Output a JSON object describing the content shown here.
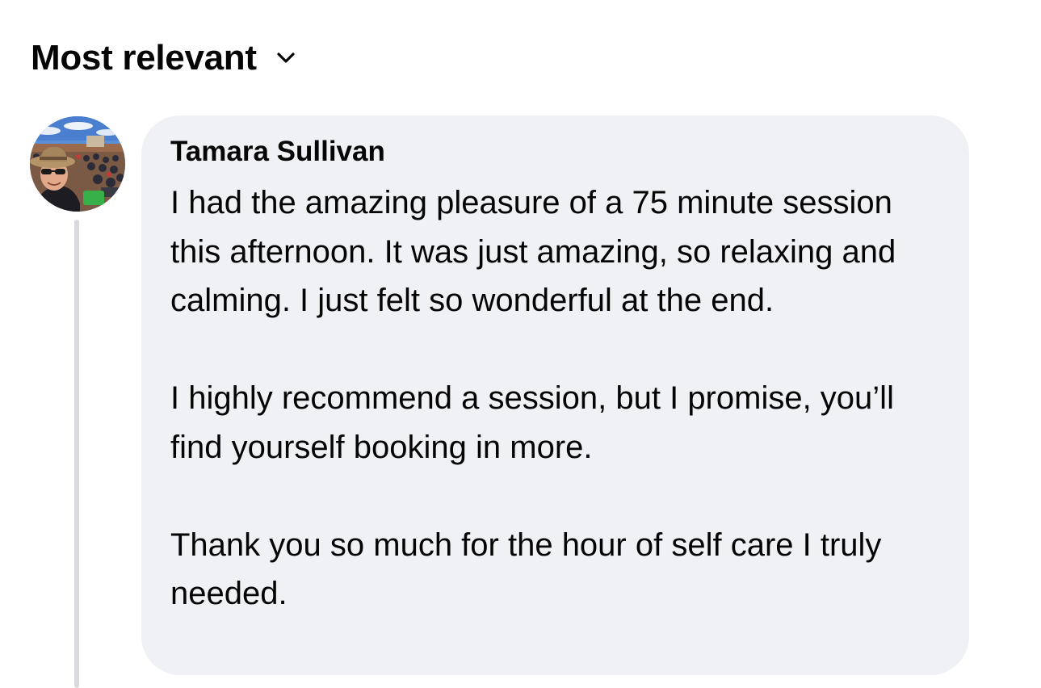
{
  "sort": {
    "label": "Most relevant",
    "icon": "chevron-down-icon"
  },
  "comment": {
    "author": "Tamara Sullivan",
    "avatar_icon": "profile-photo-avatar",
    "paragraphs": [
      "I had the amazing pleasure of a 75 minute session this afternoon. It was just amazing, so relaxing and calming. I just felt so wonderful at the end.",
      "I highly recommend a session, but I promise, you’ll find yourself booking in more.",
      "Thank you so much for the hour of self care I truly needed."
    ]
  },
  "colors": {
    "bubble_background": "#f0f1f5",
    "text": "#050505",
    "thread_line": "#d8dade"
  }
}
